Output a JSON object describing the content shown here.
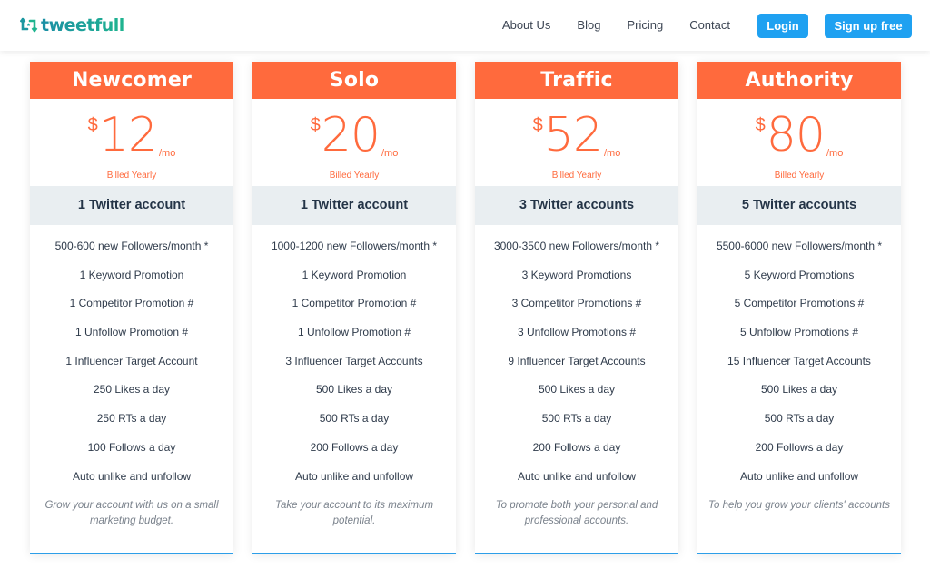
{
  "brand": {
    "name": "tweetfull",
    "logo_icon": "retweet-star-icon",
    "colors": {
      "primary_teal": "#1aa39a",
      "accent_orange": "#ff6a3d",
      "button_blue": "#1fa1f1",
      "band_grey": "#e9eef1"
    }
  },
  "nav": {
    "links": [
      "About Us",
      "Blog",
      "Pricing",
      "Contact"
    ],
    "login_label": "Login",
    "signup_label": "Sign up free"
  },
  "plans": [
    {
      "name": "Newcomer",
      "currency": "$",
      "price": "12",
      "period": "/mo",
      "billing": "Billed Yearly",
      "accounts": "1 Twitter account",
      "features": [
        "500-600 new Followers/month *",
        "1 Keyword Promotion",
        "1 Competitor Promotion #",
        "1 Unfollow Promotion #",
        "1 Influencer Target Account",
        "250 Likes a day",
        "250 RTs a day",
        "100 Follows a day",
        "Auto unlike and unfollow"
      ],
      "description": "Grow your account with us on a small marketing budget."
    },
    {
      "name": "Solo",
      "currency": "$",
      "price": "20",
      "period": "/mo",
      "billing": "Billed Yearly",
      "accounts": "1 Twitter account",
      "features": [
        "1000-1200 new Followers/month *",
        "1 Keyword Promotion",
        "1 Competitor Promotion #",
        "1 Unfollow Promotion #",
        "3 Influencer Target Accounts",
        "500 Likes a day",
        "500 RTs a day",
        "200 Follows a day",
        "Auto unlike and unfollow"
      ],
      "description": "Take your account to its maximum potential."
    },
    {
      "name": "Traffic",
      "currency": "$",
      "price": "52",
      "period": "/mo",
      "billing": "Billed Yearly",
      "accounts": "3 Twitter accounts",
      "features": [
        "3000-3500 new Followers/month *",
        "3 Keyword Promotions",
        "3 Competitor Promotions #",
        "3 Unfollow Promotions #",
        "9 Influencer Target Accounts",
        "500 Likes a day",
        "500 RTs a day",
        "200 Follows a day",
        "Auto unlike and unfollow"
      ],
      "description": "To promote both your personal and professional accounts."
    },
    {
      "name": "Authority",
      "currency": "$",
      "price": "80",
      "period": "/mo",
      "billing": "Billed Yearly",
      "accounts": "5 Twitter accounts",
      "features": [
        "5500-6000 new Followers/month *",
        "5 Keyword Promotions",
        "5 Competitor Promotions #",
        "5 Unfollow Promotions #",
        "15 Influencer Target Accounts",
        "500 Likes a day",
        "500 RTs a day",
        "200 Follows a day",
        "Auto unlike and unfollow"
      ],
      "description": "To help you grow your clients' accounts"
    }
  ]
}
